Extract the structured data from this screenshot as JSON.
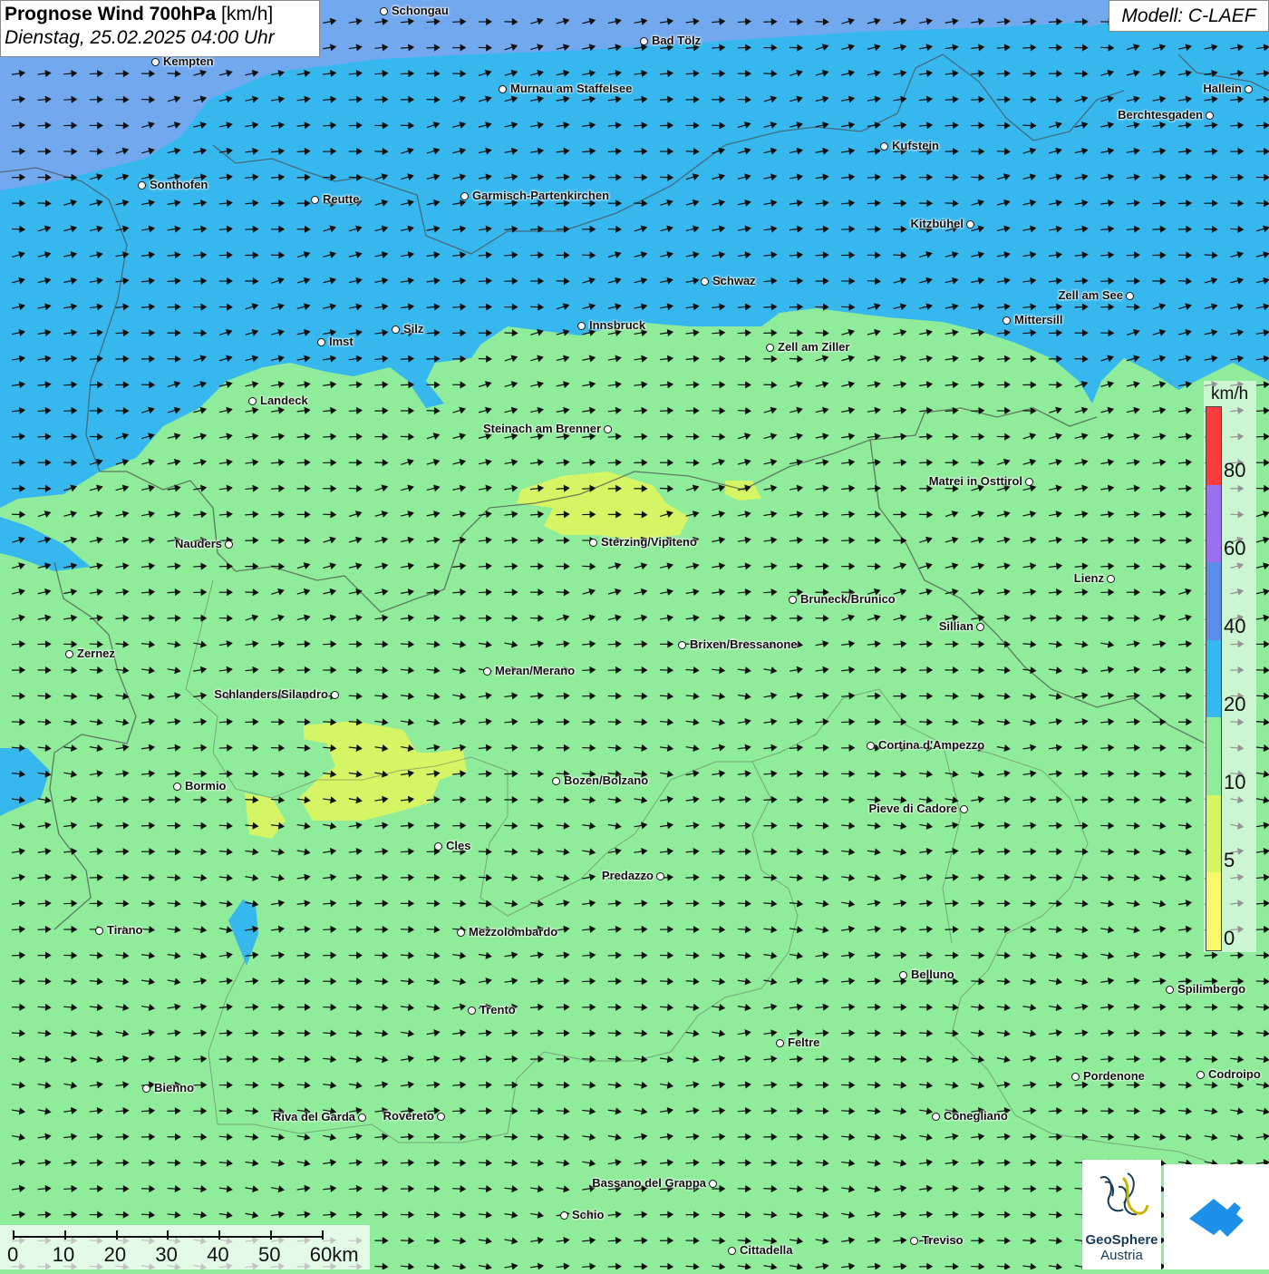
{
  "header": {
    "title": "Prognose Wind 700hPa",
    "unit": "[km/h]",
    "datetime": "Dienstag, 25.02.2025 04:00 Uhr"
  },
  "model": "Modell: C-LAEF",
  "legend": {
    "unit": "km/h",
    "ticks": [
      "80",
      "60",
      "40",
      "20",
      "10",
      "5",
      "0"
    ],
    "colors": [
      "#ff3b3b",
      "#9a6ff0",
      "#5b8de8",
      "#36b8ee",
      "#8fec9a",
      "#d6f565",
      "#fbf76a"
    ]
  },
  "scalebar": {
    "labels": [
      "0",
      "10",
      "20",
      "30",
      "40",
      "50",
      "60km"
    ]
  },
  "logos": {
    "geosphere_line1": "GeoSphere",
    "geosphere_line2": "Austria"
  },
  "wind_direction": "west-southwest to east-northeast",
  "cities": [
    {
      "name": "Schongau"
    },
    {
      "name": "Bad Tölz"
    },
    {
      "name": "Kempten"
    },
    {
      "name": "Murnau am Staffelsee"
    },
    {
      "name": "Hallein"
    },
    {
      "name": "Berchtesgaden"
    },
    {
      "name": "Kufstein"
    },
    {
      "name": "Sonthofen"
    },
    {
      "name": "Reutte"
    },
    {
      "name": "Garmisch-Partenkirchen"
    },
    {
      "name": "Kitzbühel"
    },
    {
      "name": "Schwaz"
    },
    {
      "name": "Zell am See"
    },
    {
      "name": "Silz"
    },
    {
      "name": "Innsbruck"
    },
    {
      "name": "Mittersill"
    },
    {
      "name": "Imst"
    },
    {
      "name": "Zell am Ziller"
    },
    {
      "name": "Landeck"
    },
    {
      "name": "Steinach am Brenner"
    },
    {
      "name": "Matrei in Osttirol"
    },
    {
      "name": "Nauders"
    },
    {
      "name": "Sterzing/Vipiteno"
    },
    {
      "name": "Lienz"
    },
    {
      "name": "Bruneck/Brunico"
    },
    {
      "name": "Sillian"
    },
    {
      "name": "Zernez"
    },
    {
      "name": "Brixen/Bressanone"
    },
    {
      "name": "Meran/Merano"
    },
    {
      "name": "Schlanders/Silandro"
    },
    {
      "name": "Cortina d'Ampezzo"
    },
    {
      "name": "Bozen/Bolzano"
    },
    {
      "name": "Bormio"
    },
    {
      "name": "Pieve di Cadore"
    },
    {
      "name": "Cles"
    },
    {
      "name": "Predazzo"
    },
    {
      "name": "Tirano"
    },
    {
      "name": "Mezzolombardo"
    },
    {
      "name": "Belluno"
    },
    {
      "name": "Spilimbergo"
    },
    {
      "name": "Trento"
    },
    {
      "name": "Feltre"
    },
    {
      "name": "Pordenone"
    },
    {
      "name": "Codroipo"
    },
    {
      "name": "Bienno"
    },
    {
      "name": "Riva del Garda"
    },
    {
      "name": "Rovereto"
    },
    {
      "name": "Conegliano"
    },
    {
      "name": "Bassano del Grappa"
    },
    {
      "name": "Schio"
    },
    {
      "name": "Treviso"
    },
    {
      "name": "Cittadella"
    }
  ]
}
